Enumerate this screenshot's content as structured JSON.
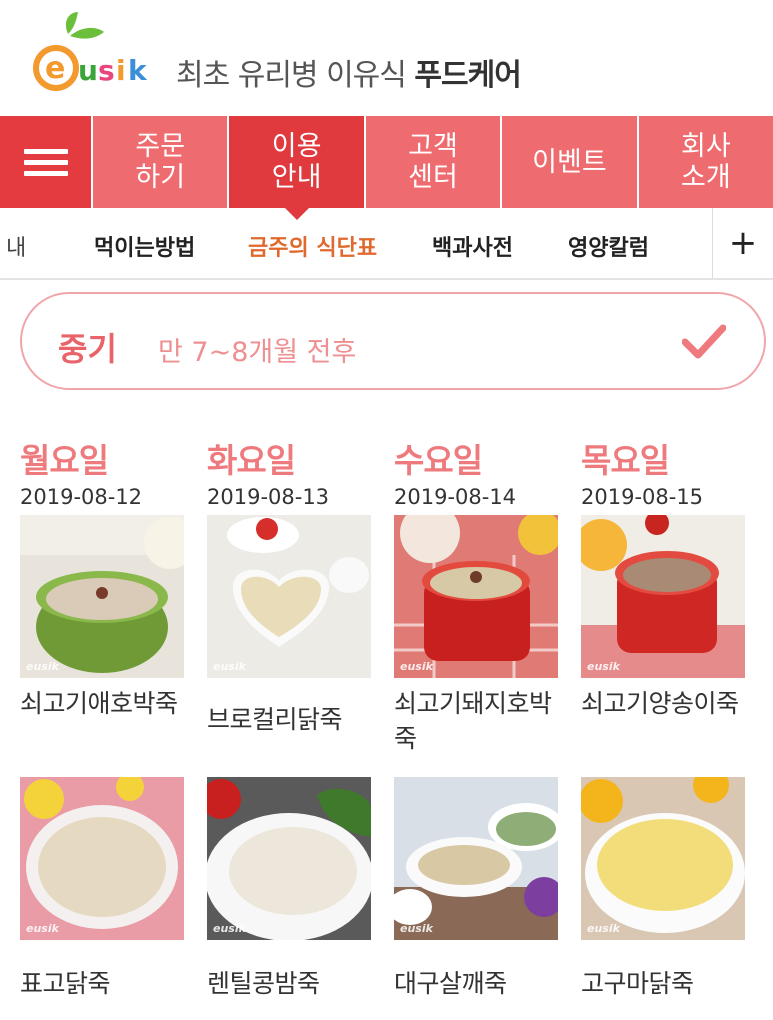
{
  "header": {
    "logo_text": "eusik",
    "tagline_plain": "최초 유리병 이유식 ",
    "tagline_bold": "푸드케어"
  },
  "main_nav": {
    "items": [
      {
        "label": "주문\n하기",
        "active": false
      },
      {
        "label": "이용\n안내",
        "active": true
      },
      {
        "label": "고객\n센터",
        "active": false
      },
      {
        "label": "이벤트",
        "active": false
      },
      {
        "label": "회사\n소개",
        "active": false
      }
    ]
  },
  "sub_nav": {
    "items": [
      {
        "label": "내",
        "active": false
      },
      {
        "label": "먹이는방법",
        "active": false
      },
      {
        "label": "금주의 식단표",
        "active": true
      },
      {
        "label": "백과사전",
        "active": false
      },
      {
        "label": "영양칼럼",
        "active": false
      }
    ],
    "more_label": "+"
  },
  "stage": {
    "name": "중기",
    "description": "만 7~8개월 전후"
  },
  "days": [
    {
      "name": "월요일",
      "date": "2019-08-12"
    },
    {
      "name": "화요일",
      "date": "2019-08-13"
    },
    {
      "name": "수요일",
      "date": "2019-08-14"
    },
    {
      "name": "목요일",
      "date": "2019-08-15"
    }
  ],
  "menu_rows": [
    [
      {
        "name": "쇠고기애호박죽"
      },
      {
        "name": "브로컬리닭죽"
      },
      {
        "name": "쇠고기돼지호박죽"
      },
      {
        "name": "쇠고기양송이죽"
      }
    ],
    [
      {
        "name": "표고닭죽"
      },
      {
        "name": "렌틸콩밤죽"
      },
      {
        "name": "대구살깨죽"
      },
      {
        "name": "고구마닭죽"
      }
    ]
  ],
  "watermark": "eusik",
  "colors": {
    "nav_red": "#e8474c",
    "nav_active": "#e03a3f",
    "accent_orange": "#e06a2e",
    "day_pink": "#ee7a7e"
  }
}
